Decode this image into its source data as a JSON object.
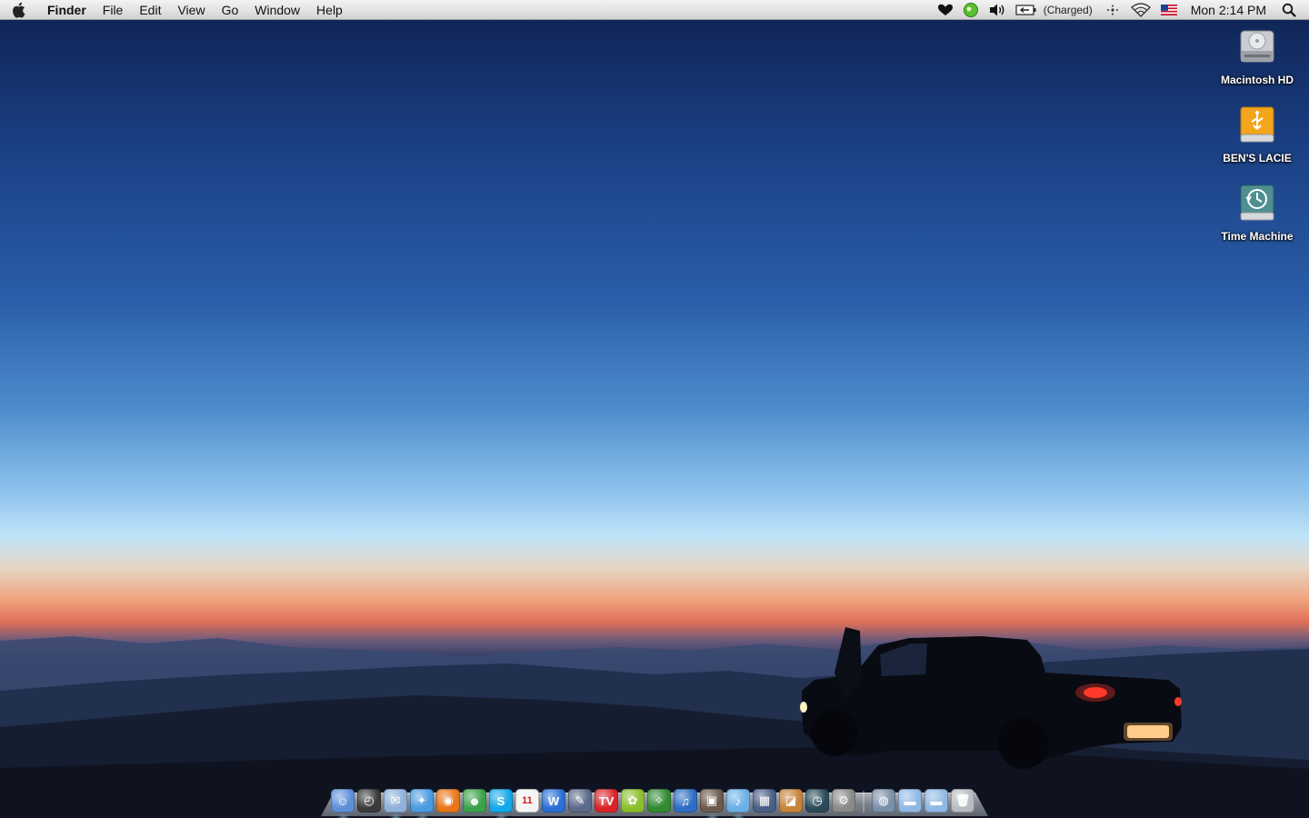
{
  "menubar": {
    "app_name": "Finder",
    "menus": [
      "File",
      "Edit",
      "View",
      "Go",
      "Window",
      "Help"
    ],
    "status_items": [
      {
        "name": "heart-icon",
        "glyph": "❤"
      },
      {
        "name": "growl-icon",
        "glyph": "●"
      },
      {
        "name": "volume-icon",
        "glyph": "🔊"
      },
      {
        "name": "battery-icon",
        "glyph": "▭"
      }
    ],
    "battery_text": "(Charged)",
    "clock": "Mon 2:14 PM"
  },
  "desktop": {
    "icons": [
      {
        "label": "Macintosh HD",
        "kind": "internal-drive-icon"
      },
      {
        "label": "BEN'S LACIE",
        "kind": "usb-drive-icon"
      },
      {
        "label": "Time Machine",
        "kind": "time-machine-drive-icon"
      }
    ]
  },
  "dock": {
    "apps": [
      {
        "name": "finder",
        "color": "#5d8fd8",
        "glyph": "☺",
        "running": true
      },
      {
        "name": "dashboard",
        "color": "#3b3b3b",
        "glyph": "◴",
        "running": false
      },
      {
        "name": "mail",
        "color": "#8fb1d9",
        "glyph": "✉",
        "running": true
      },
      {
        "name": "safari",
        "color": "#4a9be0",
        "glyph": "✦",
        "running": true
      },
      {
        "name": "firefox",
        "color": "#e8751a",
        "glyph": "◉",
        "running": false
      },
      {
        "name": "messenger",
        "color": "#3aa24b",
        "glyph": "☻",
        "running": false
      },
      {
        "name": "skype",
        "color": "#12a8e8",
        "glyph": "S",
        "running": true
      },
      {
        "name": "ical",
        "color": "#f4f4f4",
        "glyph": "11",
        "running": false
      },
      {
        "name": "word",
        "color": "#2b6fd6",
        "glyph": "W",
        "running": false
      },
      {
        "name": "pen-app",
        "color": "#5a6a8a",
        "glyph": "✎",
        "running": false
      },
      {
        "name": "tv-app",
        "color": "#d8252a",
        "glyph": "TV",
        "running": false
      },
      {
        "name": "green-app",
        "color": "#8bbf2a",
        "glyph": "✿",
        "running": false
      },
      {
        "name": "fireworks-app",
        "color": "#2f8a30",
        "glyph": "✧",
        "running": false
      },
      {
        "name": "blue-app",
        "color": "#2d6ec4",
        "glyph": "♫",
        "running": false
      },
      {
        "name": "photo-app",
        "color": "#6b5a4e",
        "glyph": "▣",
        "running": true
      },
      {
        "name": "itunes",
        "color": "#6ab0e6",
        "glyph": "♪",
        "running": true
      },
      {
        "name": "spaces",
        "color": "#4a5e86",
        "glyph": "▦",
        "running": false
      },
      {
        "name": "iphoto",
        "color": "#c7843a",
        "glyph": "◪",
        "running": false
      },
      {
        "name": "time-machine",
        "color": "#2a4a5a",
        "glyph": "◷",
        "running": false
      },
      {
        "name": "system-preferences",
        "color": "#8a8a8a",
        "glyph": "⚙",
        "running": false
      }
    ],
    "stacks": [
      {
        "name": "network-stack",
        "color": "#7a8fa8",
        "glyph": "◍"
      },
      {
        "name": "documents-stack",
        "color": "#8fb8e4",
        "glyph": "▬"
      },
      {
        "name": "downloads-stack",
        "color": "#8fb8e4",
        "glyph": "▬"
      },
      {
        "name": "trash",
        "color": "#b8bcc2",
        "glyph": "🗑"
      }
    ]
  }
}
